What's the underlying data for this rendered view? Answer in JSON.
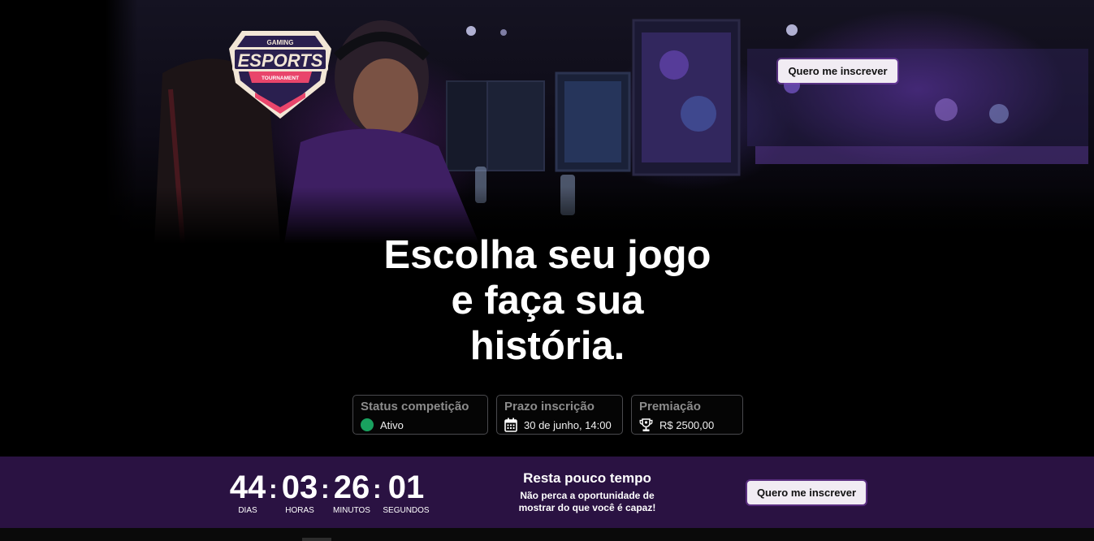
{
  "logo": {
    "top_text": "GAMING",
    "main_text": "ESPORTS",
    "ribbon_text": "TOURNAMENT"
  },
  "header": {
    "cta_label": "Quero me inscrever"
  },
  "hero": {
    "headline_lines": [
      "Escolha seu jogo",
      "e faça sua",
      "história."
    ]
  },
  "info_cards": [
    {
      "title": "Status competição",
      "value": "Ativo",
      "icon": "status-dot-icon"
    },
    {
      "title": "Prazo inscrição",
      "value": "30 de junho, 14:00",
      "icon": "calendar-icon"
    },
    {
      "title": "Premiação",
      "value": "R$ 2500,00",
      "icon": "trophy-icon"
    }
  ],
  "countdown": {
    "units": [
      {
        "value": "44",
        "label": "DIAS"
      },
      {
        "value": "03",
        "label": "HORAS"
      },
      {
        "value": "26",
        "label": "MINUTOS"
      },
      {
        "value": "01",
        "label": "SEGUNDOS"
      }
    ],
    "separator": ":"
  },
  "hurry": {
    "title": "Resta pouco tempo",
    "text_lines": [
      "Não perca a oportunidade de",
      "mostrar do que você é capaz!"
    ]
  },
  "footer_band": {
    "cta_label": "Quero me inscrever"
  },
  "colors": {
    "accent_purple": "#2a1242",
    "status_green": "#19a15f",
    "button_bg": "#f1ecf3",
    "card_border": "#4a4a4e",
    "logo_pink": "#e9456b",
    "logo_navy": "#2a1f4f"
  }
}
